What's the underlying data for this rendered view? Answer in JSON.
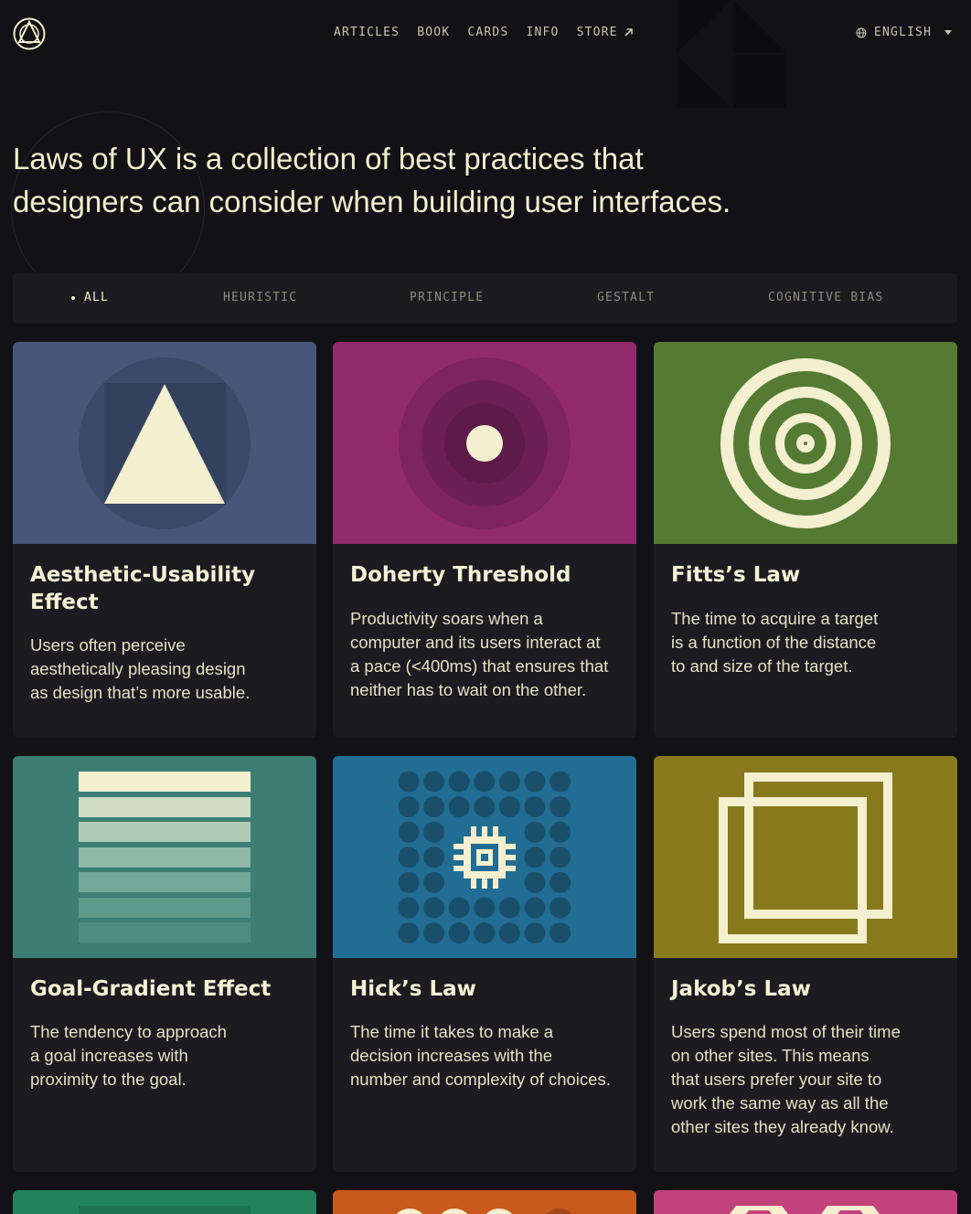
{
  "nav": {
    "logo_alt": "Laws of UX logo",
    "items": [
      "ARTICLES",
      "BOOK",
      "CARDS",
      "INFO",
      "STORE"
    ],
    "store_external_icon": "arrow-up-right-icon",
    "language": "ENGLISH"
  },
  "hero": {
    "line1": "Laws of UX is a collection of best practices that",
    "line2": "designers can consider when building user interfaces."
  },
  "filters": {
    "items": [
      "ALL",
      "HEURISTIC",
      "PRINCIPLE",
      "GESTALT",
      "COGNITIVE BIAS"
    ],
    "active": "ALL"
  },
  "cards": [
    {
      "title": "Aesthetic-Usability Effect",
      "lines": [
        "Users often perceive",
        "aesthetically pleasing design",
        "as design that’s more usable."
      ],
      "color": "#485779"
    },
    {
      "title": "Doherty Threshold",
      "lines": [
        "Productivity soars when a",
        "computer and its users interact at",
        "a pace (<400ms) that ensures that",
        "neither has to wait on the other."
      ],
      "color": "#922b6e"
    },
    {
      "title": "Fitts’s Law",
      "lines": [
        "The time to acquire a target",
        "is a function of the distance",
        "to and size of the target."
      ],
      "color": "#547a33"
    },
    {
      "title": "Goal-Gradient Effect",
      "lines": [
        "The tendency to approach",
        "a goal increases with",
        "proximity to the goal."
      ],
      "color": "#3c7e74"
    },
    {
      "title": "Hick’s Law",
      "lines": [
        "The time it takes to make a",
        "decision increases with the",
        "number and complexity of choices."
      ],
      "color": "#216d93"
    },
    {
      "title": "Jakob’s Law",
      "lines": [
        "Users spend most of their time",
        "on other sites. This means",
        "that users prefer your site to",
        "work the same way as all the",
        "other sites they already know."
      ],
      "color": "#887a1c"
    }
  ],
  "partial_cards": [
    {
      "color": "#22825a"
    },
    {
      "color": "#c9591c"
    },
    {
      "color": "#c3437c"
    }
  ]
}
